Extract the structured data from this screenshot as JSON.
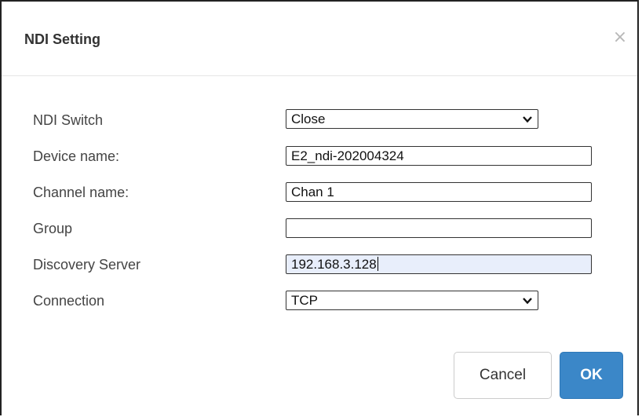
{
  "dialog": {
    "title": "NDI Setting",
    "close_symbol": "×",
    "close_icon": "close-icon"
  },
  "form": {
    "ndi_switch": {
      "label": "NDI Switch",
      "value": "Close"
    },
    "device_name": {
      "label": "Device name:",
      "value": "E2_ndi-202004324"
    },
    "channel_name": {
      "label": "Channel name:",
      "value": "Chan 1"
    },
    "group": {
      "label": "Group",
      "value": ""
    },
    "discovery_server": {
      "label": "Discovery Server",
      "value": "192.168.3.128"
    },
    "connection": {
      "label": "Connection",
      "value": "TCP"
    }
  },
  "footer": {
    "cancel_label": "Cancel",
    "ok_label": "OK"
  },
  "colors": {
    "primary": "#3b87c8",
    "focused_field": "#e8eefb"
  }
}
